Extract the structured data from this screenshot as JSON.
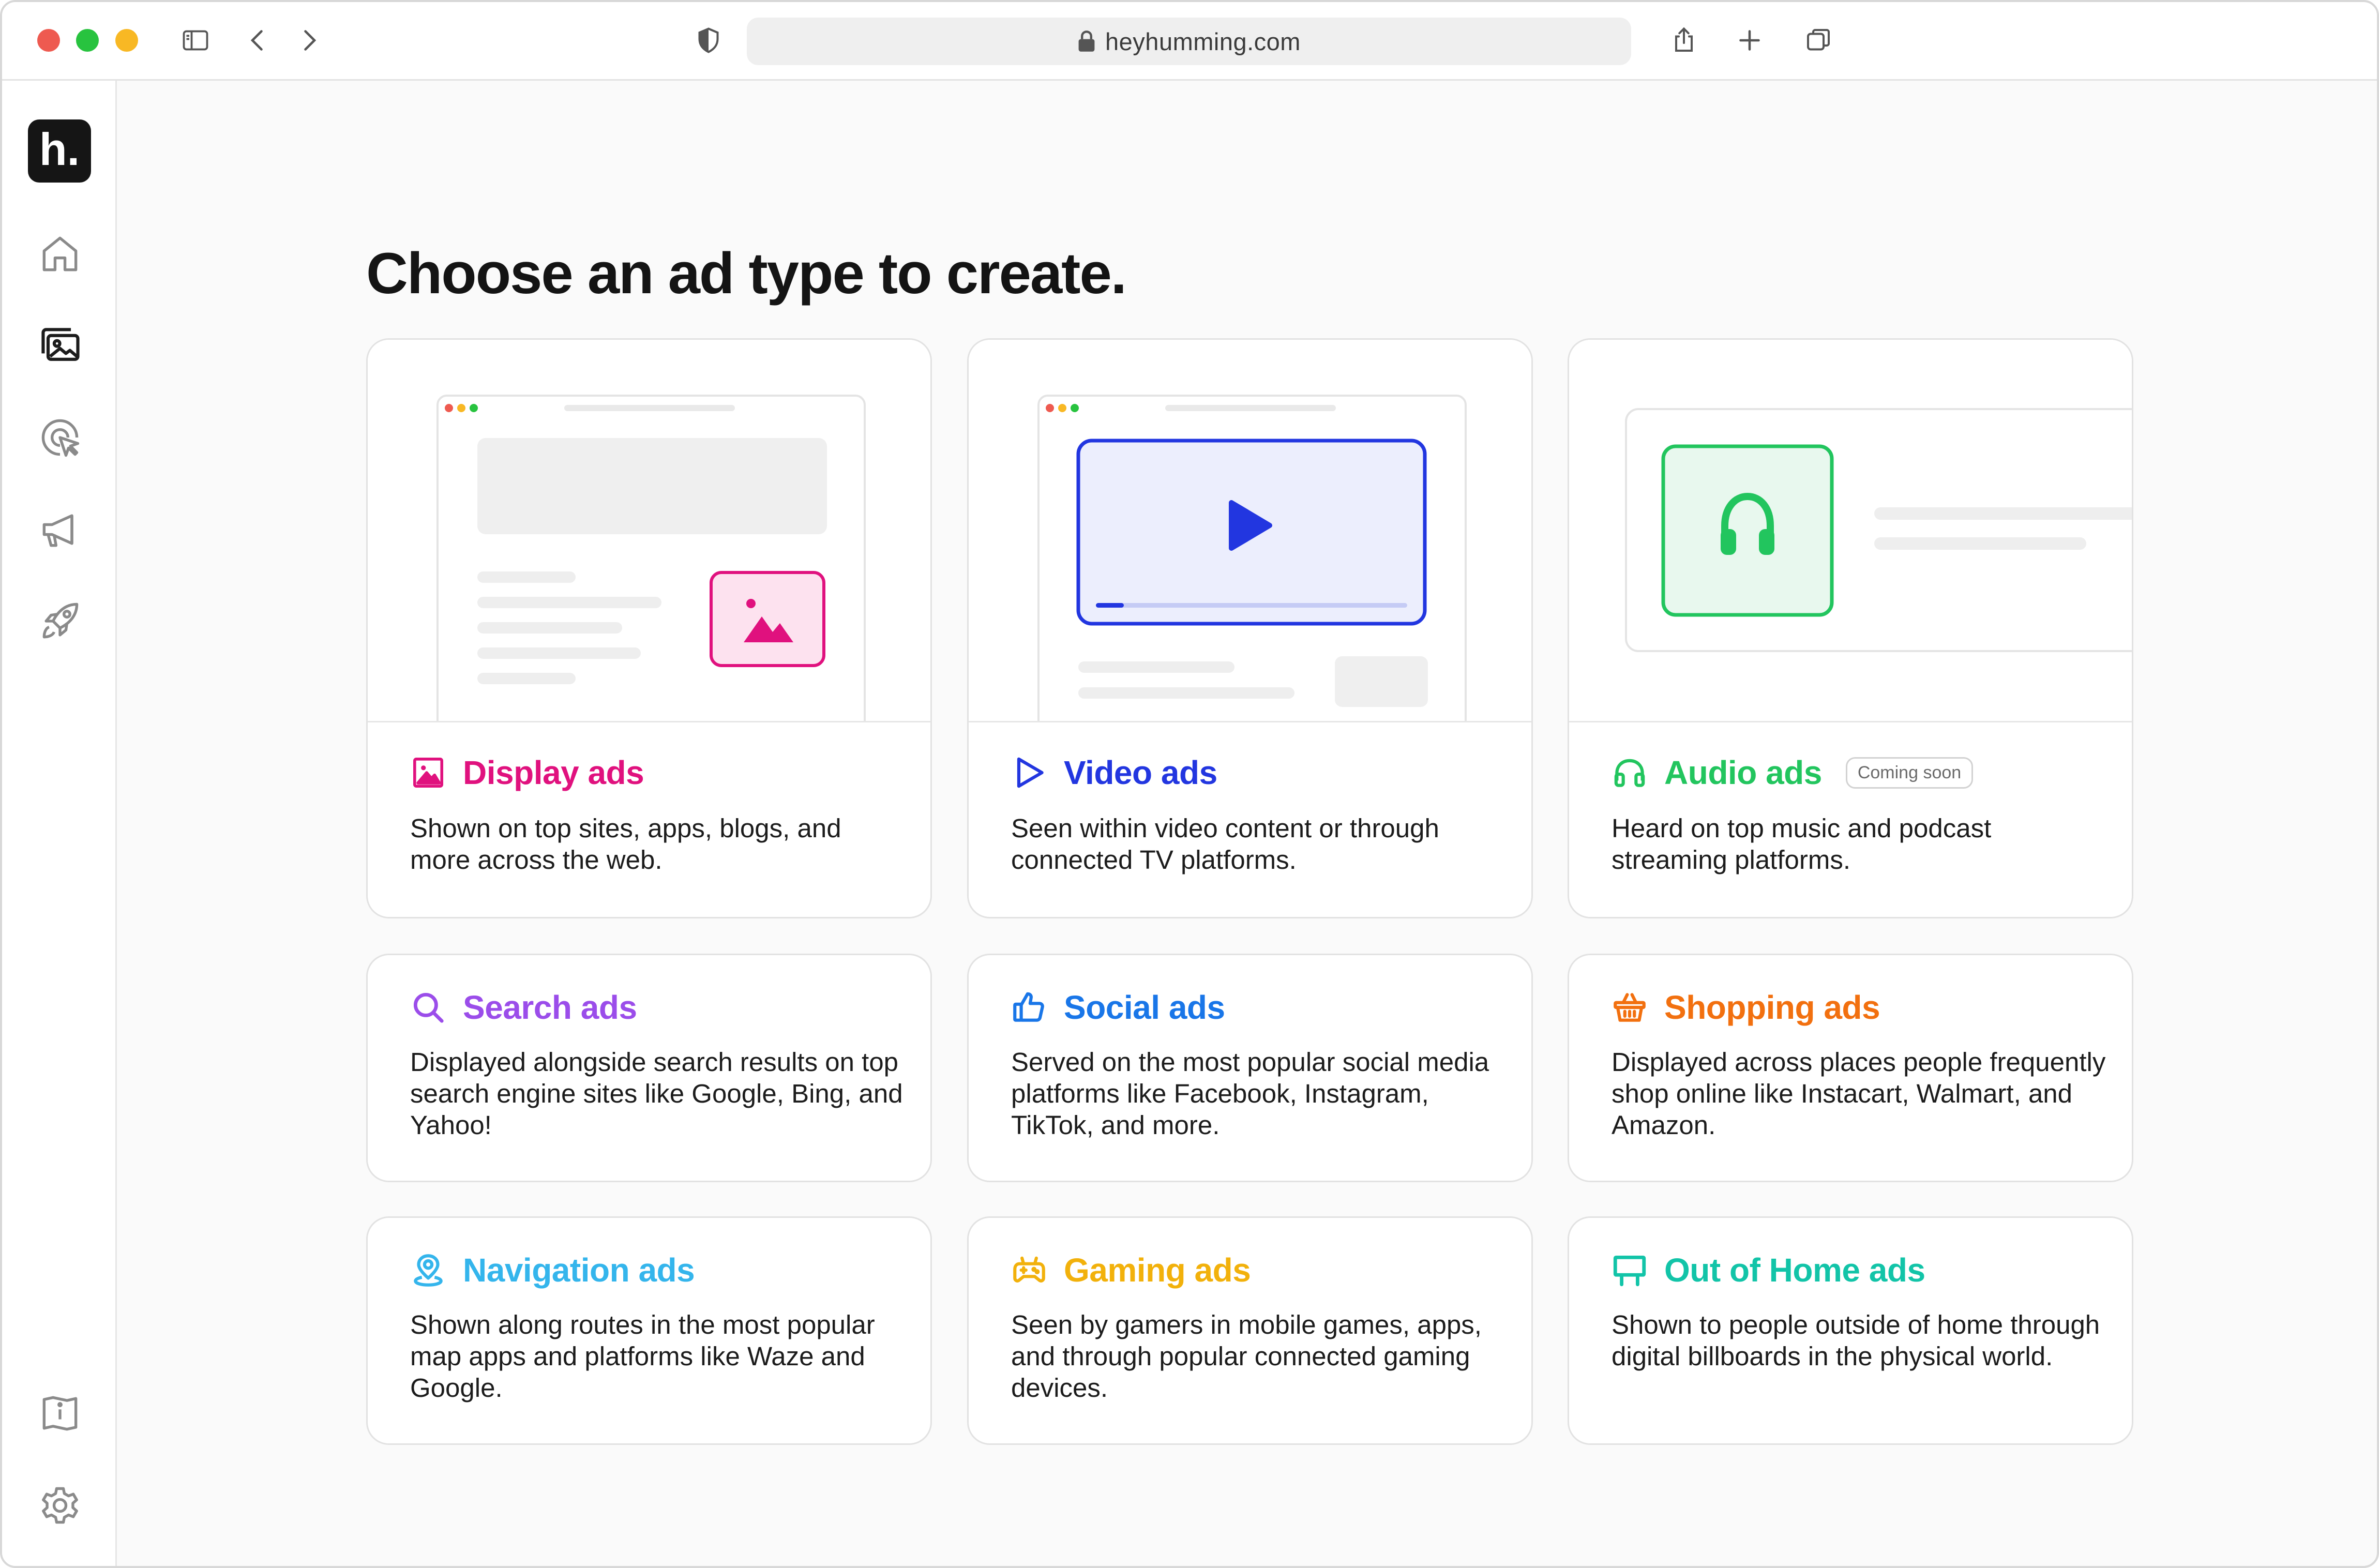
{
  "browser": {
    "url": "heyhumming.com",
    "traffic_lights": [
      "#ee5a50",
      "#28c33f",
      "#f8b824"
    ]
  },
  "sidebar": {
    "logo_text": "h.",
    "nav_icons": [
      "home-icon",
      "gallery-icon",
      "target-cursor-icon",
      "megaphone-icon",
      "rocket-icon"
    ],
    "bottom_icons": [
      "info-book-icon",
      "gear-icon"
    ]
  },
  "main": {
    "heading": "Choose an ad type to create."
  },
  "ad_types": [
    {
      "title": "Display ads",
      "description": "Shown on top sites, apps, blogs, and more across the web.",
      "color": "#e0117e",
      "icon": "image-icon"
    },
    {
      "title": "Video ads",
      "description": "Seen within video content or through connected TV platforms.",
      "color": "#2236e0",
      "icon": "play-icon"
    },
    {
      "title": "Audio ads",
      "badge": "Coming soon",
      "description": "Heard on top music and podcast streaming platforms.",
      "color": "#22c55e",
      "icon": "headphones-icon"
    },
    {
      "title": "Search ads",
      "description": "Displayed alongside search results on top search engine sites like Google, Bing, and Yahoo!",
      "color": "#9b4dea",
      "icon": "search-icon"
    },
    {
      "title": "Social ads",
      "description": "Served on the most popular social media platforms like Facebook, Instagram, TikTok, and more.",
      "color": "#1976e8",
      "icon": "thumbs-up-icon"
    },
    {
      "title": "Shopping ads",
      "description": "Displayed across places people frequently shop online like Instacart, Walmart, and Amazon.",
      "color": "#f2700f",
      "icon": "basket-icon"
    },
    {
      "title": "Navigation ads",
      "description": "Shown along routes in the most popular map apps and platforms like Waze and Google.",
      "color": "#34b5ec",
      "icon": "map-pin-icon"
    },
    {
      "title": "Gaming ads",
      "description": "Seen by gamers in mobile games, apps, and through popular connected gaming devices.",
      "color": "#f2b10b",
      "icon": "gamepad-icon"
    },
    {
      "title": "Out of Home ads",
      "description": "Shown to people outside of home through digital billboards in the physical world.",
      "color": "#12c4a8",
      "icon": "billboard-icon"
    }
  ]
}
